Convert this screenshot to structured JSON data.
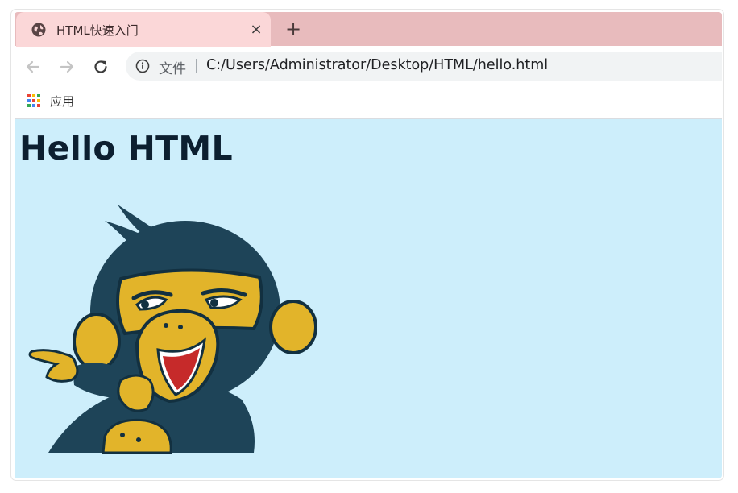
{
  "tab": {
    "title": "HTML快速入门",
    "close": "×",
    "new_tab": "+"
  },
  "address": {
    "scheme_label": "文件",
    "separator": "|",
    "url": "C:/Users/Administrator/Desktop/HTML/hello.html"
  },
  "bookmarks": {
    "apps_label": "应用"
  },
  "page": {
    "heading": "Hello HTML",
    "background": "#cdeefb",
    "image_alt_name": "cartoon-monkey-pointing"
  },
  "colors": {
    "tab_active": "#fbd7d8",
    "tab_strip": "#e8bbbd",
    "monkey_dark": "#1e4458",
    "monkey_yellow": "#e2b42a"
  },
  "icons": [
    "globe-icon",
    "close-icon",
    "plus-icon",
    "back-arrow-icon",
    "forward-arrow-icon",
    "reload-icon",
    "info-icon",
    "apps-grid-icon"
  ]
}
